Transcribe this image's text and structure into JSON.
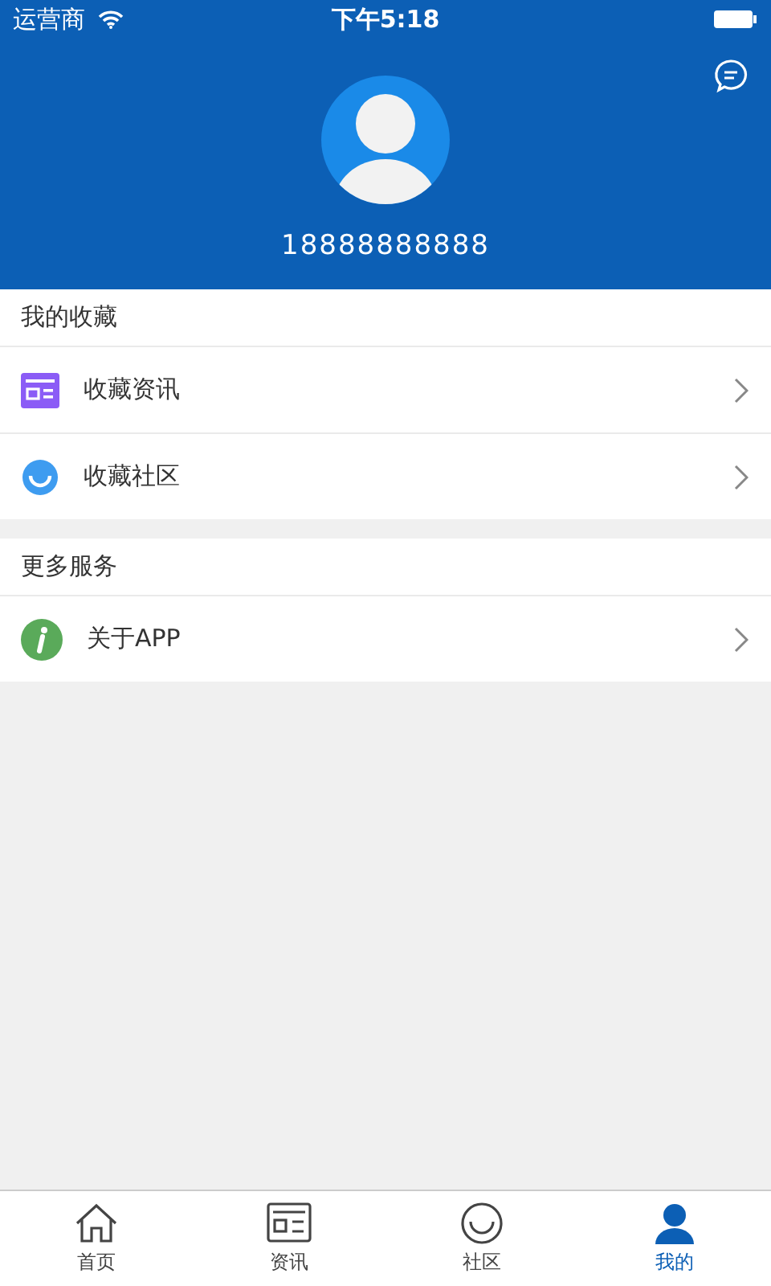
{
  "status_bar": {
    "carrier": "运营商",
    "time": "下午5:18"
  },
  "profile": {
    "phone": "18888888888"
  },
  "sections": [
    {
      "title": "我的收藏",
      "items": [
        {
          "label": "收藏资讯",
          "kind": "news"
        },
        {
          "label": "收藏社区",
          "kind": "community"
        }
      ]
    },
    {
      "title": "更多服务",
      "items": [
        {
          "label": "关于APP",
          "kind": "info"
        }
      ]
    }
  ],
  "tabs": [
    {
      "label": "首页",
      "kind": "home",
      "selected": false
    },
    {
      "label": "资讯",
      "kind": "news",
      "selected": false
    },
    {
      "label": "社区",
      "kind": "community",
      "selected": false
    },
    {
      "label": "我的",
      "kind": "me",
      "selected": true
    }
  ]
}
